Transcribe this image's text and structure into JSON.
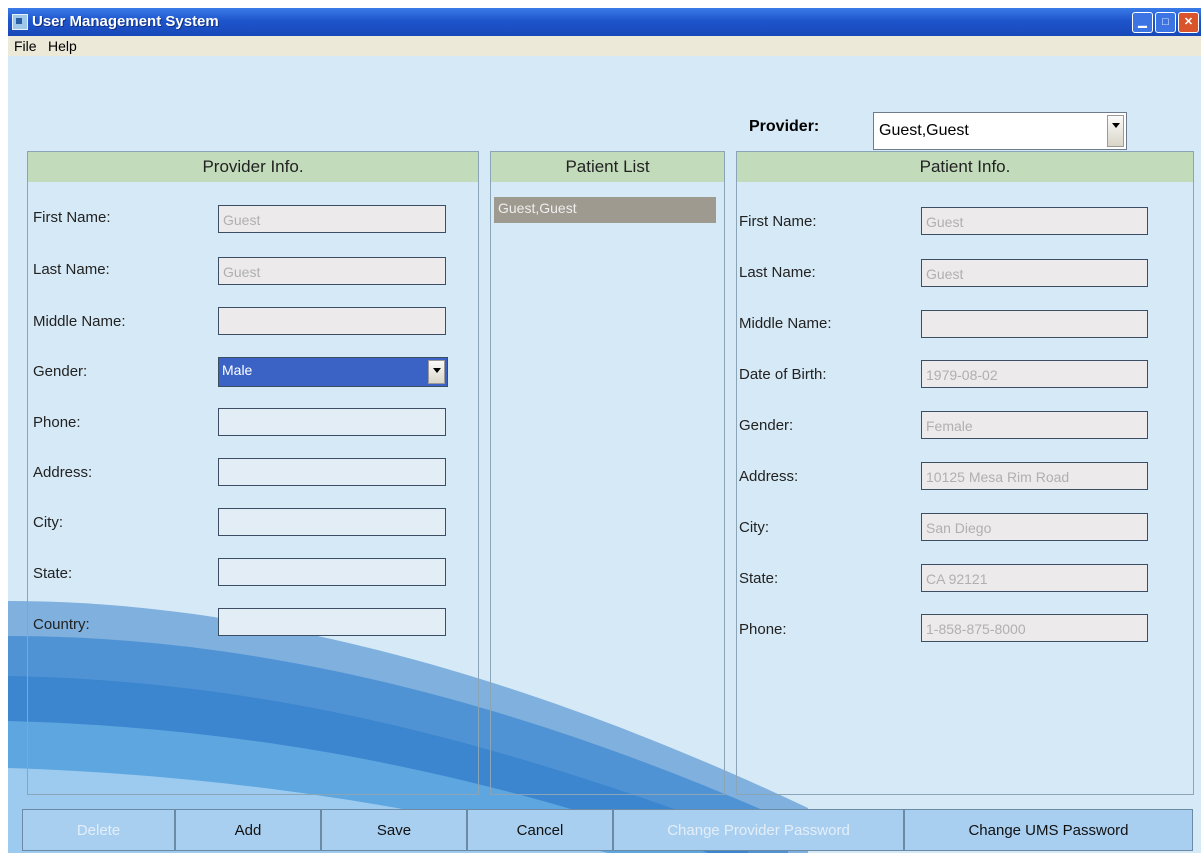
{
  "window": {
    "title": "User Management System",
    "controls": [
      "minimize",
      "maximize",
      "close"
    ]
  },
  "menu": {
    "file": "File",
    "help": "Help"
  },
  "provider": {
    "label": "Provider:",
    "selected": "Guest,Guest"
  },
  "provider_info": {
    "header": "Provider Info.",
    "first_name": {
      "label": "First Name:",
      "value": "Guest"
    },
    "last_name": {
      "label": "Last Name:",
      "value": "Guest"
    },
    "middle_name": {
      "label": "Middle Name:",
      "value": ""
    },
    "gender": {
      "label": "Gender:",
      "value": "Male"
    },
    "phone": {
      "label": "Phone:",
      "value": ""
    },
    "address": {
      "label": "Address:",
      "value": ""
    },
    "city": {
      "label": "City:",
      "value": ""
    },
    "state": {
      "label": "State:",
      "value": ""
    },
    "country": {
      "label": "Country:",
      "value": ""
    }
  },
  "patient_list": {
    "header": "Patient List",
    "items": [
      "Guest,Guest"
    ]
  },
  "patient_info": {
    "header": "Patient Info.",
    "first_name": {
      "label": "First Name:",
      "value": "Guest"
    },
    "last_name": {
      "label": "Last Name:",
      "value": "Guest"
    },
    "middle_name": {
      "label": "Middle Name:",
      "value": ""
    },
    "dob": {
      "label": "Date of Birth:",
      "value": "1979-08-02"
    },
    "gender": {
      "label": "Gender:",
      "value": "Female"
    },
    "address": {
      "label": "Address:",
      "value": "10125 Mesa Rim Road"
    },
    "city": {
      "label": "City:",
      "value": "San Diego"
    },
    "state": {
      "label": "State:",
      "value": "CA 92121"
    },
    "phone": {
      "label": "Phone:",
      "value": "1-858-875-8000"
    }
  },
  "buttons": {
    "delete": "Delete",
    "add": "Add",
    "save": "Save",
    "cancel": "Cancel",
    "change_provider_password": "Change Provider Password",
    "change_ums_password": "Change UMS Password"
  },
  "colors": {
    "titlebar": "#1e55cc",
    "background": "#d6e9f6",
    "panel_header": "#c2dbbb",
    "selection": "#3b63c6",
    "button": "#a9cff0"
  }
}
